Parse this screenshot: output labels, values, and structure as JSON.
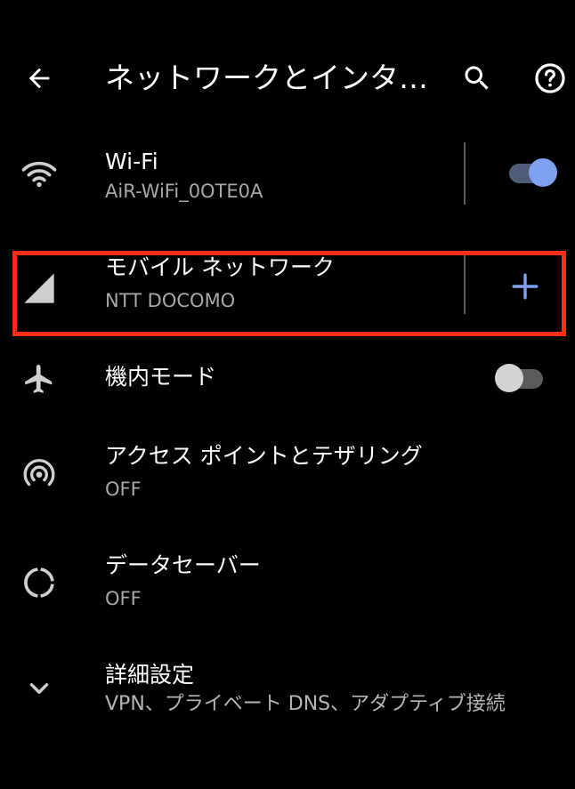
{
  "header": {
    "title": "ネットワークとインタ…",
    "back_icon": "arrow-back-icon",
    "search_icon": "search-icon",
    "help_icon": "help-circle-icon"
  },
  "items": [
    {
      "key": "wifi",
      "title": "Wi-Fi",
      "subtitle": "AiR-WiFi_0OTE0A",
      "icon": "wifi-icon",
      "toggle": "on"
    },
    {
      "key": "mobile_network",
      "title": "モバイル ネットワーク",
      "subtitle": "NTT DOCOMO",
      "icon": "signal-icon",
      "action_icon": "plus-icon",
      "highlighted": true
    },
    {
      "key": "airplane_mode",
      "title": "機内モード",
      "icon": "airplane-icon",
      "toggle": "off"
    },
    {
      "key": "hotspot",
      "title": "アクセス ポイントとテザリング",
      "subtitle": "OFF",
      "icon": "hotspot-icon"
    },
    {
      "key": "data_saver",
      "title": "データセーバー",
      "subtitle": "OFF",
      "icon": "data-saver-icon"
    },
    {
      "key": "advanced",
      "title": "詳細設定",
      "subtitle": "VPN、プライベート DNS、アダプティブ接続",
      "icon": "chevron-down-icon"
    }
  ],
  "colors": {
    "background": "#000000",
    "text_primary": "#ffffff",
    "text_secondary": "#a8a8a8",
    "accent": "#7ea2ef",
    "highlight_border": "#ff2d14"
  }
}
